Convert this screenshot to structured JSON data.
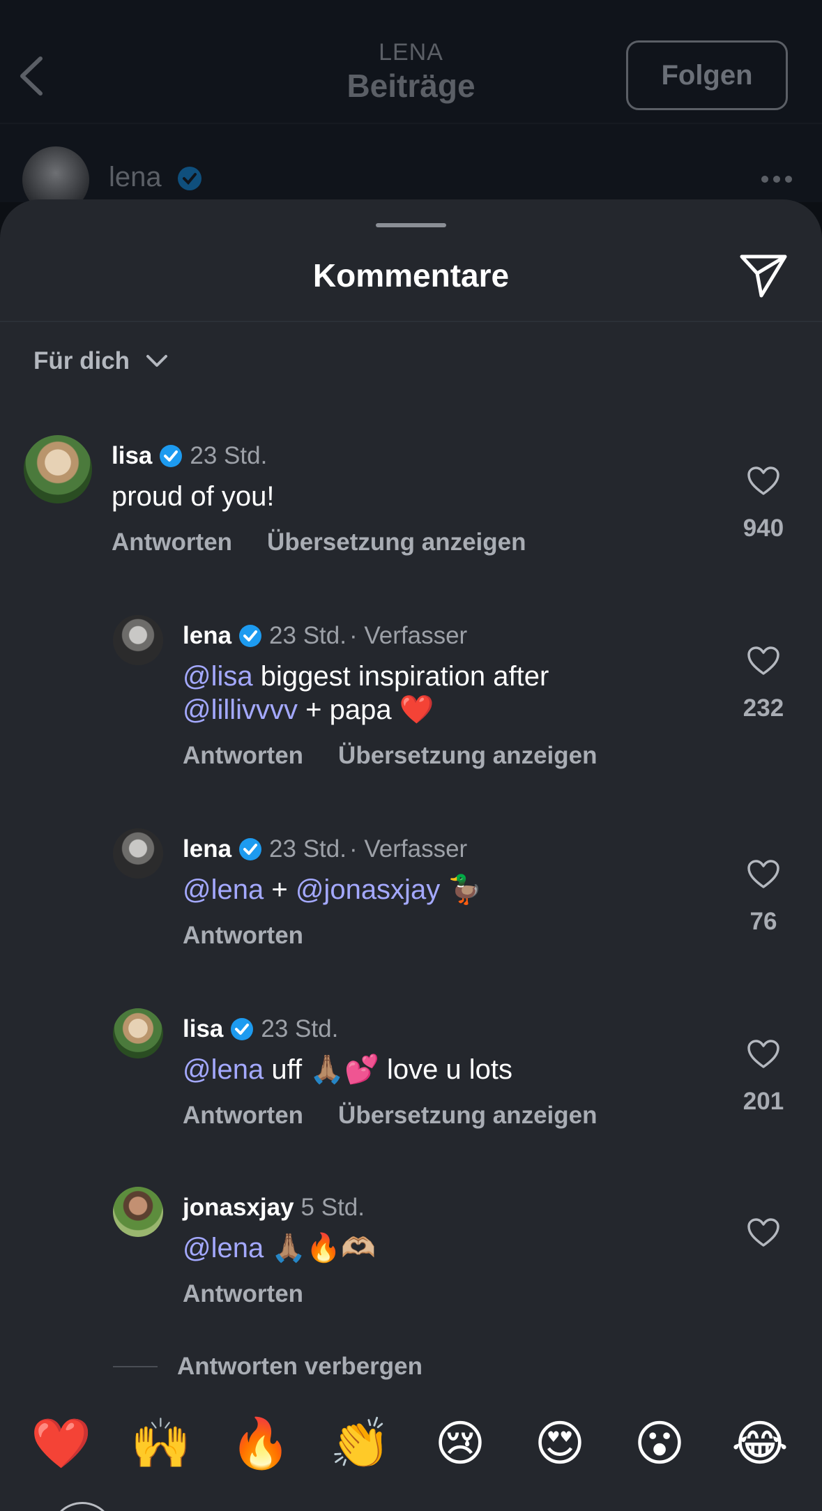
{
  "header": {
    "owner": "LENA",
    "title": "Beiträge",
    "follow_label": "Folgen",
    "post_username": "lena"
  },
  "sheet": {
    "title": "Kommentare",
    "filter_label": "Für dich",
    "hide_replies_label": "Antworten verbergen"
  },
  "comments": [
    {
      "username": "lisa",
      "time": "23 Std.",
      "author_tag": "",
      "text_parts": [
        "proud of you!"
      ],
      "reply_label": "Antworten",
      "translate_label": "Übersetzung anzeigen",
      "likes": "940"
    },
    {
      "username": "lena",
      "time": "23 Std.",
      "author_tag": "· Verfasser",
      "mention1": "@lisa",
      "text1": " biggest inspiration after",
      "mention2": "@lillivvvv",
      "text2": " + papa ",
      "emoji": "❤️",
      "reply_label": "Antworten",
      "translate_label": "Übersetzung anzeigen",
      "likes": "232"
    },
    {
      "username": "lena",
      "time": "23 Std.",
      "author_tag": "· Verfasser",
      "mention1": "@lena",
      "text1": " + ",
      "mention2": "@jonasxjay",
      "emoji": "🦆",
      "reply_label": "Antworten",
      "likes": "76"
    },
    {
      "username": "lisa",
      "time": "23 Std.",
      "mention1": "@lena",
      "text1": " uff ",
      "emoji": "🙏🏽💕",
      "text2": " love u lots",
      "reply_label": "Antworten",
      "translate_label": "Übersetzung anzeigen",
      "likes": "201"
    },
    {
      "username": "jonasxjay",
      "time": "5 Std.",
      "mention1": "@lena",
      "emoji": "🙏🏽🔥🫶🏼",
      "reply_label": "Antworten",
      "likes": ""
    }
  ],
  "reactions": [
    "❤️",
    "🙌",
    "🔥",
    "👏",
    "😢",
    "😍",
    "😮",
    "😂"
  ],
  "colors": {
    "sheet_bg": "#24272d",
    "mention": "#a4a9ff",
    "verified": "#1d9bf0",
    "secondary_text": "#a9adb4"
  }
}
